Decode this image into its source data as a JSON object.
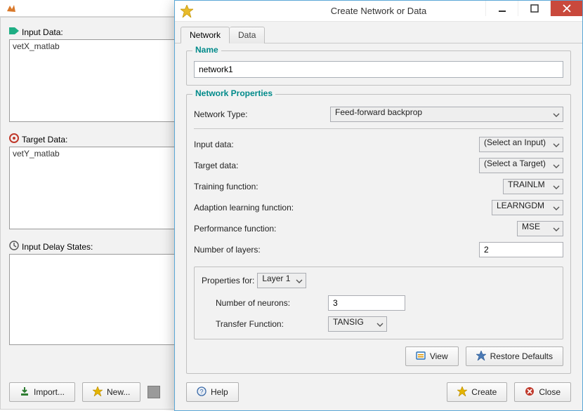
{
  "bgwin": {
    "input_data_label": "Input Data:",
    "input_data_item": "vetX_matlab",
    "target_data_label": "Target Data:",
    "target_data_item": "vetY_matlab",
    "delay_label": "Input Delay States:",
    "import_btn": "Import...",
    "new_btn": "New..."
  },
  "dialog": {
    "title": "Create Network or Data",
    "tabs": {
      "network": "Network",
      "data": "Data"
    },
    "name_legend": "Name",
    "name_value": "network1",
    "np_legend": "Network Properties",
    "labels": {
      "network_type": "Network Type:",
      "input_data": "Input data:",
      "target_data": "Target data:",
      "training_fn": "Training function:",
      "adapt_fn": "Adaption learning function:",
      "perf_fn": "Performance function:",
      "num_layers": "Number of layers:",
      "props_for": "Properties for:",
      "num_neurons": "Number of neurons:",
      "transfer_fn": "Transfer Function:"
    },
    "values": {
      "network_type": "Feed-forward backprop",
      "input_data": "(Select an Input)",
      "target_data": "(Select a Target)",
      "training_fn": "TRAINLM",
      "adapt_fn": "LEARNGDM",
      "perf_fn": "MSE",
      "num_layers": "2",
      "props_for": "Layer 1",
      "num_neurons": "3",
      "transfer_fn": "TANSIG"
    },
    "buttons": {
      "view": "View",
      "restore": "Restore Defaults",
      "help": "Help",
      "create": "Create",
      "close": "Close"
    }
  }
}
